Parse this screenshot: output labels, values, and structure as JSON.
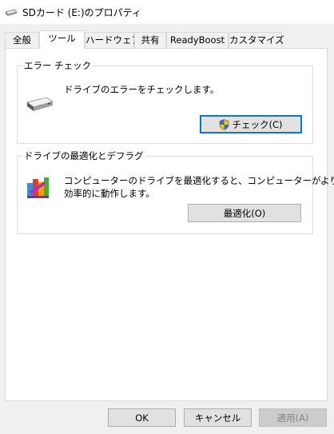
{
  "window": {
    "title": "SDカード (E:)のプロパティ",
    "icon": "drive-icon"
  },
  "tabs": [
    {
      "label": "全般",
      "active": false
    },
    {
      "label": "ツール",
      "active": true
    },
    {
      "label": "ハードウェア",
      "active": false
    },
    {
      "label": "共有",
      "active": false
    },
    {
      "label": "ReadyBoost",
      "active": false
    },
    {
      "label": "カスタマイズ",
      "active": false
    }
  ],
  "error_check": {
    "group_label": "エラー チェック",
    "description": "ドライブのエラーをチェックします。",
    "button_label": "チェック(C)",
    "icon": "hard-drive-icon",
    "button_icon": "uac-shield-icon"
  },
  "optimize": {
    "group_label": "ドライブの最適化とデフラグ",
    "description_line1": "コンピューターのドライブを最適化すると、コンピューターがより",
    "description_line2": "効率的に動作します。",
    "button_label": "最適化(O)",
    "icon": "defrag-icon"
  },
  "footer": {
    "ok_label": "OK",
    "cancel_label": "キャンセル",
    "apply_label": "適用(A)",
    "apply_enabled": false
  },
  "colors": {
    "focus_border": "#0078d7",
    "panel_bg": "#ffffff",
    "window_bg": "#f0f0f0"
  }
}
